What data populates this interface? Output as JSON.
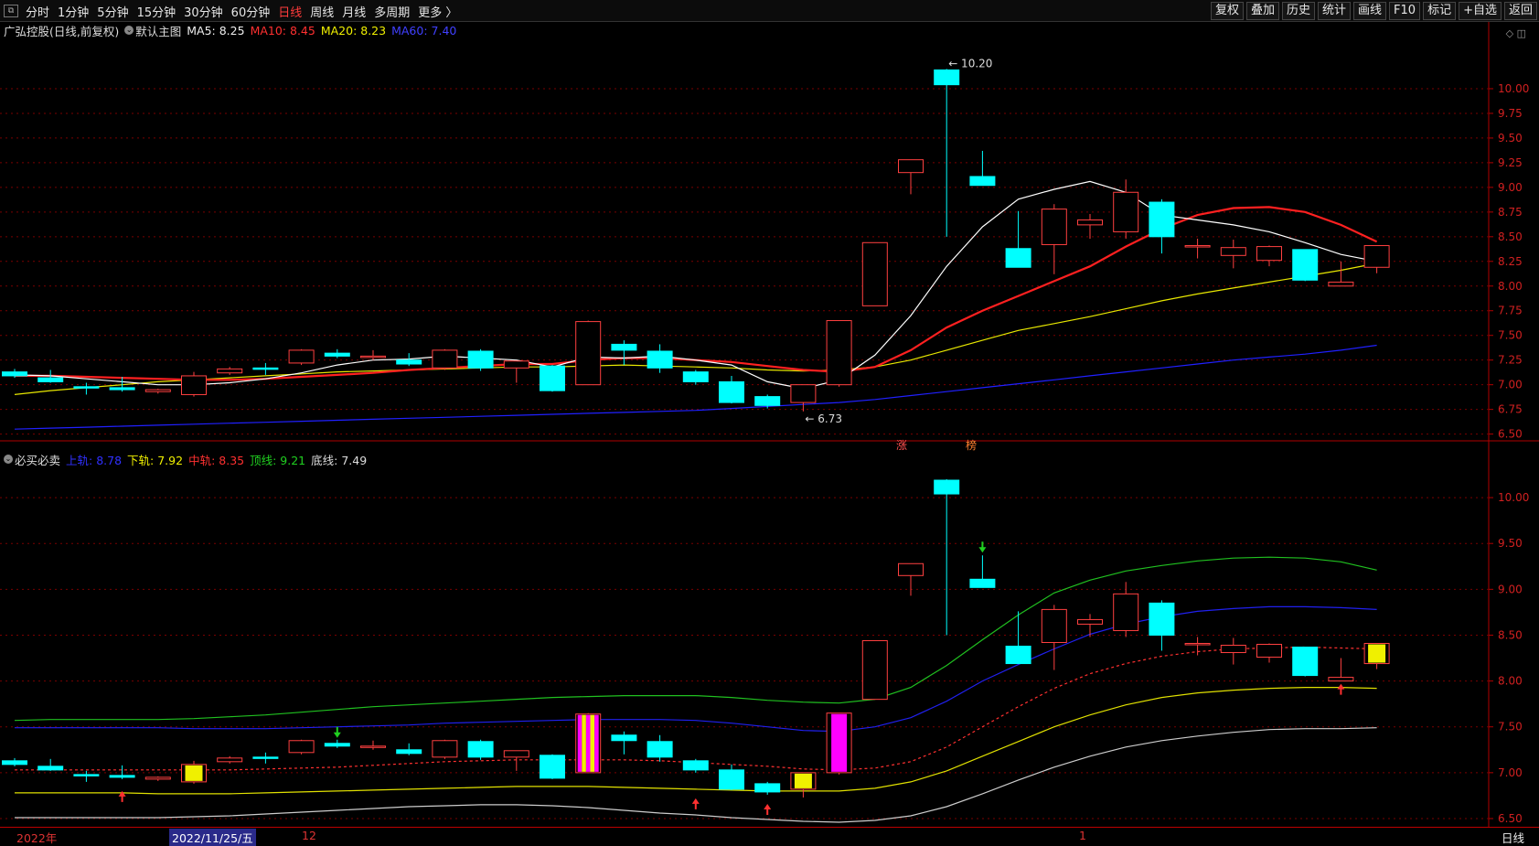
{
  "topbar": {
    "periods": [
      "分时",
      "1分钟",
      "5分钟",
      "15分钟",
      "30分钟",
      "60分钟",
      "日线",
      "周线",
      "月线",
      "多周期",
      "更多 〉"
    ],
    "active_period": "日线",
    "tools": [
      "复权",
      "叠加",
      "历史",
      "统计",
      "画线",
      "F10",
      "标记",
      "+自选",
      "返回"
    ]
  },
  "main_legend": {
    "stock": "广弘控股(日线,前复权)",
    "indicator": "默认主图",
    "ma5": "MA5: 8.25",
    "ma10": "MA10: 8.45",
    "ma20": "MA20: 8.23",
    "ma60": "MA60: 7.40"
  },
  "sub_legend": {
    "indicator": "必买必卖",
    "upper": "上轨: 8.78",
    "lower": "下轨: 7.92",
    "middle": "中轨: 8.35",
    "top": "顶线: 9.21",
    "bottom": "底线: 7.49"
  },
  "annotations": {
    "high": "10.20",
    "low": "6.73",
    "tag1": "涨",
    "tag2": "榜"
  },
  "date_axis": {
    "year": "2022年",
    "cursor": "2022/11/25/五",
    "month12": "12",
    "month1": "1",
    "period": "日线"
  },
  "colors": {
    "up": "#ff4040",
    "down": "#00ffff",
    "ma5": "#ffffff",
    "ma10": "#ff2020",
    "ma20": "#e8e800",
    "ma60": "#2020ff"
  },
  "chart_data": {
    "type": "candlestick",
    "main": {
      "y_ticks": [
        "10.00",
        "9.75",
        "9.50",
        "9.25",
        "9.00",
        "8.75",
        "8.50",
        "8.25",
        "8.00",
        "7.75",
        "7.50",
        "7.25",
        "7.00",
        "6.75",
        "6.50"
      ],
      "ylim": [
        6.45,
        10.25
      ]
    },
    "sub": {
      "y_ticks": [
        "10.00",
        "9.50",
        "9.00",
        "8.50",
        "8.00",
        "7.50",
        "7.00",
        "6.50"
      ],
      "ylim": [
        6.45,
        10.3
      ]
    },
    "candles": [
      [
        7.13,
        7.09,
        7.16,
        7.07
      ],
      [
        7.07,
        7.03,
        7.15,
        7.02
      ],
      [
        6.98,
        6.97,
        7.02,
        6.9
      ],
      [
        6.97,
        6.95,
        7.08,
        6.93
      ],
      [
        6.93,
        6.95,
        6.96,
        6.91
      ],
      [
        6.9,
        7.09,
        7.13,
        6.88
      ],
      [
        7.12,
        7.16,
        7.18,
        7.1
      ],
      [
        7.17,
        7.16,
        7.22,
        7.1
      ],
      [
        7.22,
        7.35,
        7.36,
        7.2
      ],
      [
        7.32,
        7.29,
        7.36,
        7.27
      ],
      [
        7.28,
        7.29,
        7.35,
        7.25
      ],
      [
        7.25,
        7.21,
        7.32,
        7.19
      ],
      [
        7.17,
        7.35,
        7.36,
        7.15
      ],
      [
        7.34,
        7.17,
        7.36,
        7.14
      ],
      [
        7.17,
        7.24,
        7.24,
        7.02
      ],
      [
        7.19,
        6.94,
        7.2,
        6.93
      ],
      [
        7.0,
        7.64,
        7.65,
        7.0
      ],
      [
        7.41,
        7.35,
        7.45,
        7.2
      ],
      [
        7.34,
        7.17,
        7.41,
        7.12
      ],
      [
        7.13,
        7.03,
        7.15,
        7.0
      ],
      [
        7.03,
        6.82,
        7.09,
        6.81
      ],
      [
        6.88,
        6.79,
        6.9,
        6.76
      ],
      [
        6.82,
        7.0,
        7.0,
        6.73
      ],
      [
        7.0,
        7.65,
        7.65,
        6.98
      ],
      [
        7.8,
        8.44,
        8.44,
        7.8
      ],
      [
        9.15,
        9.28,
        9.28,
        8.93
      ],
      [
        10.19,
        10.04,
        10.2,
        8.5
      ],
      [
        9.11,
        9.02,
        9.37,
        9.02
      ],
      [
        8.38,
        8.19,
        8.76,
        8.19
      ],
      [
        8.42,
        8.78,
        8.83,
        8.12
      ],
      [
        8.62,
        8.67,
        8.73,
        8.48
      ],
      [
        8.55,
        8.95,
        9.08,
        8.48
      ],
      [
        8.85,
        8.5,
        8.88,
        8.33
      ],
      [
        8.41,
        8.41,
        8.48,
        8.28
      ],
      [
        8.31,
        8.39,
        8.47,
        8.18
      ],
      [
        8.26,
        8.4,
        8.41,
        8.2
      ],
      [
        8.37,
        8.06,
        8.37,
        8.05
      ],
      [
        8.0,
        8.04,
        8.25,
        8.0
      ],
      [
        8.19,
        8.41,
        8.41,
        8.13
      ]
    ],
    "ma5": [
      7.1,
      7.09,
      7.06,
      7.03,
      7.0,
      7.0,
      7.02,
      7.06,
      7.12,
      7.2,
      7.25,
      7.26,
      7.29,
      7.27,
      7.25,
      7.18,
      7.28,
      7.27,
      7.29,
      7.25,
      7.2,
      7.03,
      6.96,
      7.05,
      7.3,
      7.7,
      8.2,
      8.6,
      8.88,
      8.98,
      9.06,
      8.95,
      8.72,
      8.67,
      8.62,
      8.55,
      8.44,
      8.32,
      8.25
    ],
    "ma10": [
      7.09,
      7.09,
      7.08,
      7.07,
      7.06,
      7.05,
      7.05,
      7.06,
      7.08,
      7.1,
      7.12,
      7.15,
      7.17,
      7.19,
      7.21,
      7.21,
      7.25,
      7.27,
      7.27,
      7.25,
      7.23,
      7.19,
      7.15,
      7.13,
      7.18,
      7.35,
      7.58,
      7.75,
      7.9,
      8.05,
      8.2,
      8.4,
      8.58,
      8.72,
      8.79,
      8.8,
      8.75,
      8.62,
      8.45
    ],
    "ma20": [
      6.9,
      6.94,
      6.97,
      7.0,
      7.03,
      7.05,
      7.07,
      7.09,
      7.11,
      7.13,
      7.14,
      7.15,
      7.16,
      7.17,
      7.18,
      7.18,
      7.19,
      7.2,
      7.19,
      7.18,
      7.17,
      7.15,
      7.14,
      7.15,
      7.18,
      7.25,
      7.35,
      7.45,
      7.55,
      7.62,
      7.69,
      7.77,
      7.85,
      7.92,
      7.98,
      8.04,
      8.1,
      8.16,
      8.23
    ],
    "ma60": [
      6.55,
      6.56,
      6.57,
      6.58,
      6.59,
      6.6,
      6.61,
      6.62,
      6.63,
      6.64,
      6.65,
      6.66,
      6.67,
      6.68,
      6.69,
      6.7,
      6.71,
      6.72,
      6.73,
      6.74,
      6.76,
      6.78,
      6.8,
      6.82,
      6.85,
      6.89,
      6.93,
      6.97,
      7.01,
      7.05,
      7.09,
      7.13,
      7.17,
      7.21,
      7.25,
      7.28,
      7.31,
      7.35,
      7.4
    ],
    "upper": [
      7.49,
      7.49,
      7.49,
      7.49,
      7.49,
      7.48,
      7.48,
      7.48,
      7.49,
      7.5,
      7.51,
      7.52,
      7.54,
      7.55,
      7.56,
      7.57,
      7.58,
      7.58,
      7.58,
      7.57,
      7.54,
      7.5,
      7.46,
      7.45,
      7.5,
      7.6,
      7.78,
      8.0,
      8.18,
      8.35,
      8.51,
      8.62,
      8.7,
      8.76,
      8.79,
      8.81,
      8.81,
      8.8,
      8.78
    ],
    "lower": [
      6.78,
      6.78,
      6.78,
      6.78,
      6.77,
      6.77,
      6.77,
      6.78,
      6.79,
      6.8,
      6.81,
      6.82,
      6.83,
      6.84,
      6.85,
      6.85,
      6.85,
      6.84,
      6.83,
      6.82,
      6.81,
      6.8,
      6.8,
      6.8,
      6.83,
      6.9,
      7.02,
      7.18,
      7.34,
      7.5,
      7.63,
      7.74,
      7.82,
      7.87,
      7.9,
      7.92,
      7.93,
      7.93,
      7.92
    ],
    "middle": [
      7.03,
      7.03,
      7.03,
      7.03,
      7.03,
      7.03,
      7.03,
      7.04,
      7.05,
      7.06,
      7.08,
      7.1,
      7.12,
      7.13,
      7.14,
      7.14,
      7.14,
      7.14,
      7.13,
      7.11,
      7.09,
      7.07,
      7.04,
      7.03,
      7.05,
      7.12,
      7.28,
      7.5,
      7.72,
      7.92,
      8.08,
      8.19,
      8.27,
      8.32,
      8.35,
      8.36,
      8.37,
      8.36,
      8.35
    ],
    "top": [
      7.57,
      7.58,
      7.58,
      7.58,
      7.58,
      7.59,
      7.61,
      7.63,
      7.66,
      7.69,
      7.72,
      7.74,
      7.76,
      7.78,
      7.8,
      7.82,
      7.83,
      7.84,
      7.84,
      7.84,
      7.82,
      7.79,
      7.77,
      7.76,
      7.8,
      7.93,
      8.17,
      8.45,
      8.72,
      8.96,
      9.1,
      9.2,
      9.26,
      9.31,
      9.34,
      9.35,
      9.34,
      9.3,
      9.21
    ],
    "bottom": [
      6.51,
      6.51,
      6.51,
      6.51,
      6.51,
      6.52,
      6.53,
      6.55,
      6.57,
      6.59,
      6.61,
      6.63,
      6.64,
      6.65,
      6.65,
      6.64,
      6.62,
      6.59,
      6.56,
      6.54,
      6.51,
      6.49,
      6.47,
      6.46,
      6.48,
      6.53,
      6.63,
      6.77,
      6.92,
      7.06,
      7.18,
      7.28,
      7.35,
      7.4,
      7.44,
      7.47,
      7.48,
      7.48,
      7.49
    ]
  }
}
